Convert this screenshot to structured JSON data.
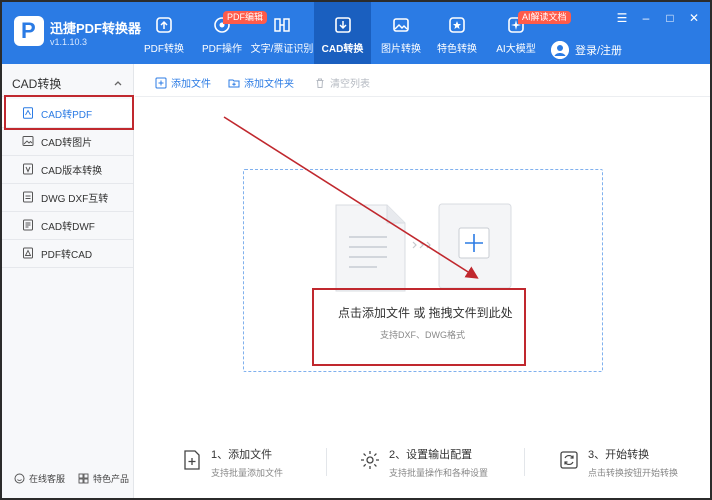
{
  "app": {
    "title": "迅捷PDF转换器",
    "version": "v1.1.10.3"
  },
  "nav": [
    {
      "label": "PDF转换",
      "icon": "pdf-convert-icon"
    },
    {
      "label": "PDF操作",
      "icon": "pdf-operate-icon",
      "badge": "PDF编辑"
    },
    {
      "label": "文字/票证识别",
      "icon": "ocr-icon"
    },
    {
      "label": "CAD转换",
      "icon": "cad-convert-icon",
      "active": true
    },
    {
      "label": "图片转换",
      "icon": "image-convert-icon"
    },
    {
      "label": "特色转换",
      "icon": "feature-convert-icon"
    },
    {
      "label": "AI大模型",
      "icon": "ai-model-icon",
      "badge": "AI解读文档"
    }
  ],
  "login_label": "登录/注册",
  "window_controls": {
    "settings": "☰",
    "minimize": "–",
    "maximize": "□",
    "close": "✕"
  },
  "sidebar": {
    "heading": "CAD转换",
    "items": [
      {
        "label": "CAD转PDF",
        "active": true
      },
      {
        "label": "CAD转图片"
      },
      {
        "label": "CAD版本转换"
      },
      {
        "label": "DWG DXF互转"
      },
      {
        "label": "CAD转DWF"
      },
      {
        "label": "PDF转CAD"
      }
    ],
    "service_label": "在线客服",
    "features_label": "特色产品"
  },
  "toolbar": {
    "add_file": "添加文件",
    "add_folder": "添加文件夹",
    "clear_list": "清空列表"
  },
  "dropzone": {
    "main_text": "点击添加文件 或 拖拽文件到此处",
    "sub_text": "支持DXF、DWG格式"
  },
  "steps": [
    {
      "title": "1、添加文件",
      "desc": "支持批量添加文件"
    },
    {
      "title": "2、设置输出配置",
      "desc": "支持批量操作和各种设置"
    },
    {
      "title": "3、开始转换",
      "desc": "点击转换按钮开始转换"
    }
  ],
  "colors": {
    "brand": "#2b7be4",
    "active_nav": "#1a5fbf",
    "badge": "#ff5b4a",
    "annotation": "#c0282e"
  }
}
